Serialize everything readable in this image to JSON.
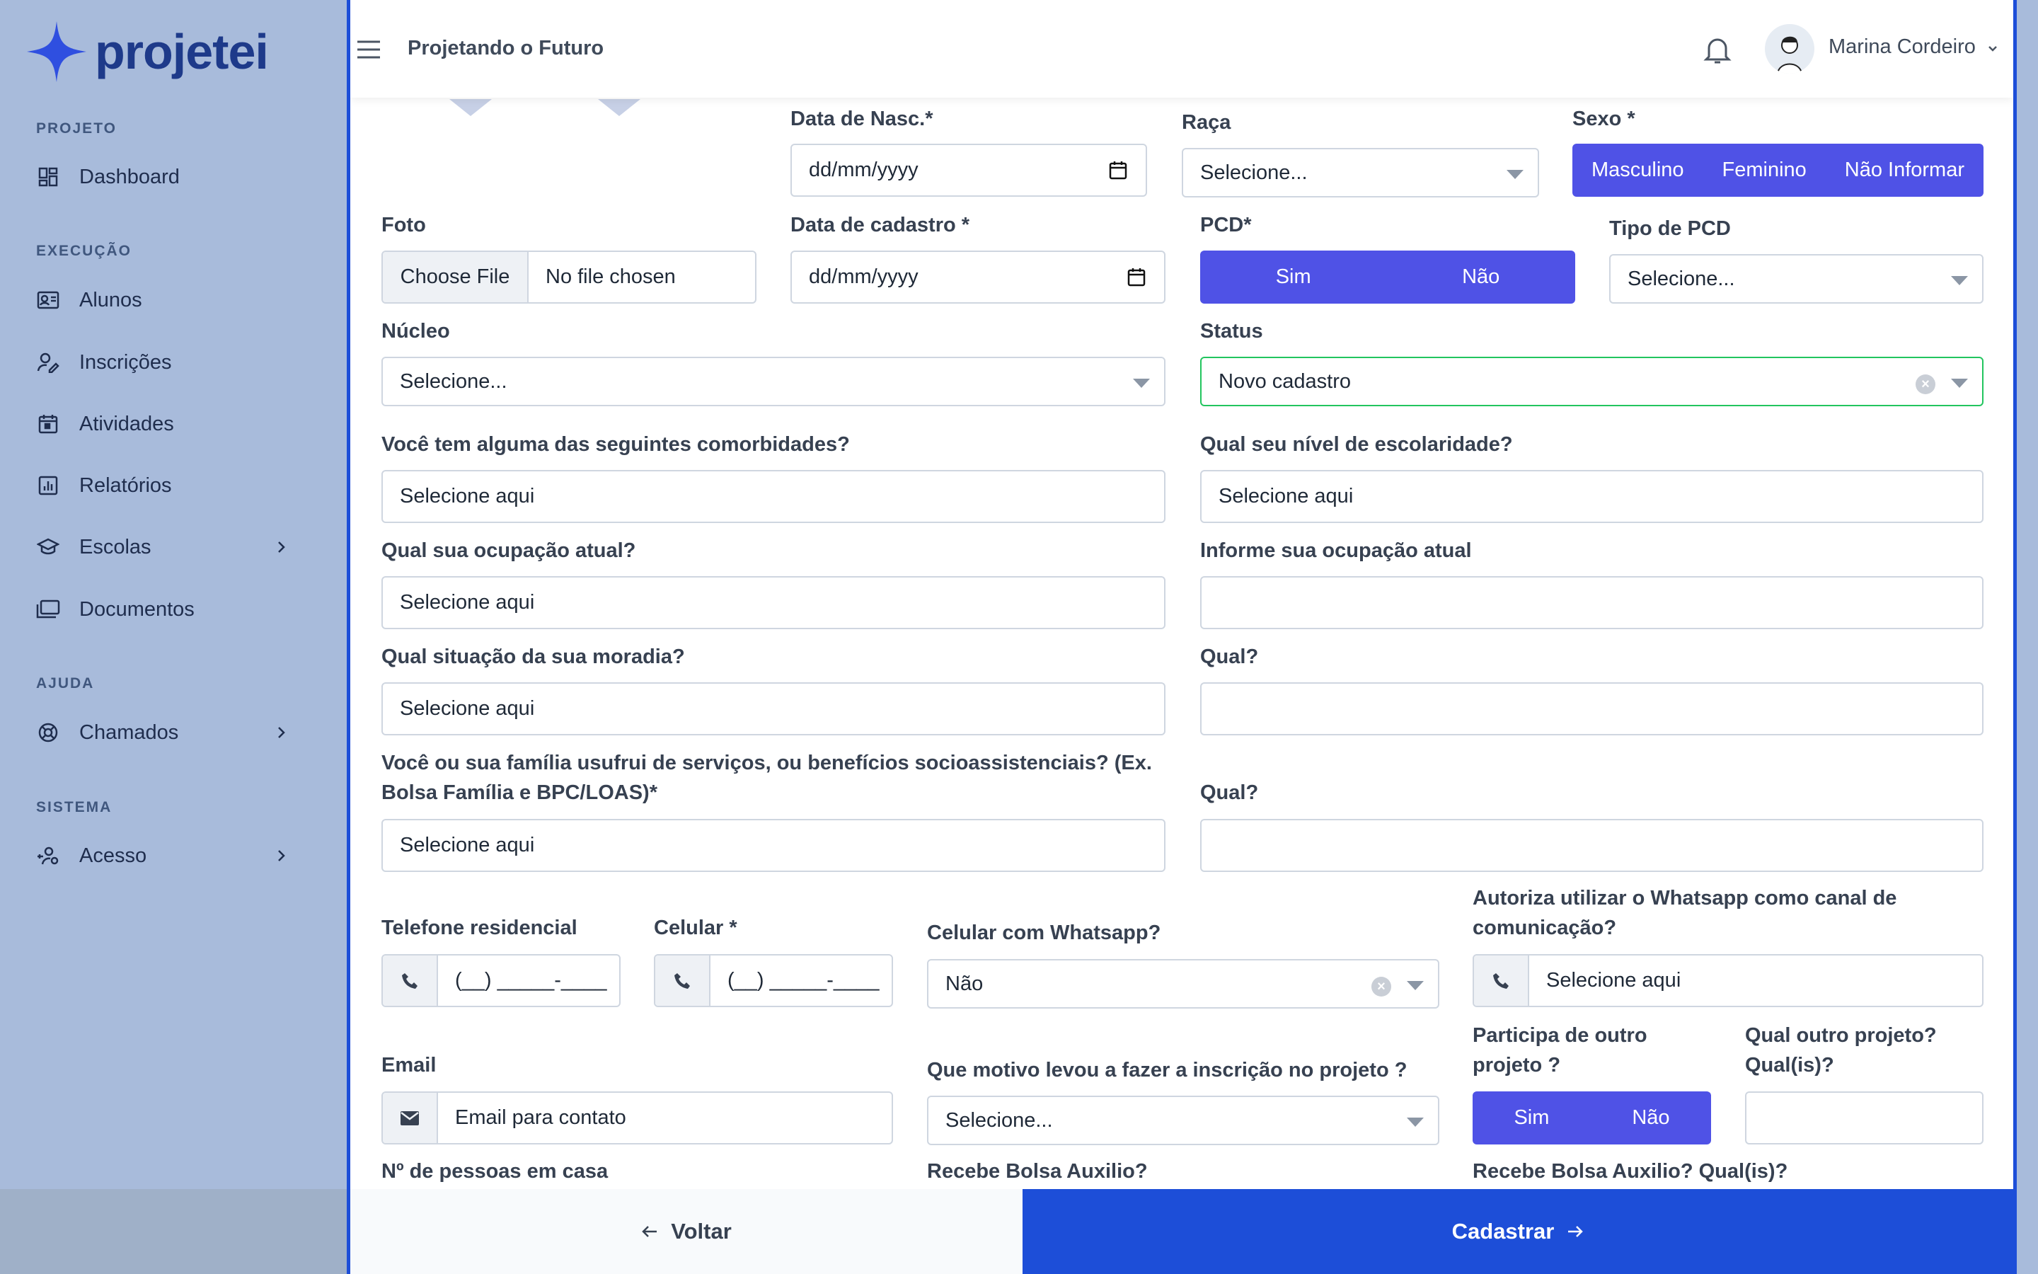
{
  "brand": {
    "name": "projetei"
  },
  "sidebar": {
    "sections": [
      {
        "title": "PROJETO"
      },
      {
        "title": "EXECUÇÃO"
      },
      {
        "title": "AJUDA"
      },
      {
        "title": "SISTEMA"
      }
    ],
    "items": [
      {
        "label": "Dashboard",
        "icon": "dashboard-icon"
      },
      {
        "label": "Alunos",
        "icon": "id-card-icon"
      },
      {
        "label": "Inscrições",
        "icon": "user-edit-icon"
      },
      {
        "label": "Atividades",
        "icon": "calendar-icon"
      },
      {
        "label": "Relatórios",
        "icon": "bar-chart-icon"
      },
      {
        "label": "Escolas",
        "icon": "graduation-cap-icon"
      },
      {
        "label": "Documentos",
        "icon": "folders-icon"
      },
      {
        "label": "Chamados",
        "icon": "lifebuoy-icon"
      },
      {
        "label": "Acesso",
        "icon": "user-key-icon"
      }
    ]
  },
  "header": {
    "title": "Projetando o Futuro",
    "user_name": "Marina Cordeiro"
  },
  "form": {
    "birth_date": {
      "label": "Data de Nasc.*",
      "placeholder": "dd/mm/yyyy"
    },
    "race": {
      "label": "Raça",
      "value": "Selecione..."
    },
    "sex": {
      "label": "Sexo *",
      "options": [
        "Masculino",
        "Feminino",
        "Não Informar"
      ]
    },
    "photo": {
      "label": "Foto",
      "button": "Choose File",
      "status": "No file chosen"
    },
    "register_date": {
      "label": "Data de cadastro *",
      "placeholder": "dd/mm/yyyy"
    },
    "pcd": {
      "label": "PCD*",
      "options": [
        "Sim",
        "Não"
      ]
    },
    "pcd_type": {
      "label": "Tipo de PCD",
      "value": "Selecione..."
    },
    "nucleus": {
      "label": "Núcleo",
      "value": "Selecione..."
    },
    "status": {
      "label": "Status",
      "value": "Novo cadastro"
    },
    "comorbidities": {
      "label": "Você tem alguma das seguintes comorbidades?",
      "value": "Selecione aqui"
    },
    "education": {
      "label": "Qual seu nível de escolaridade?",
      "value": "Selecione aqui"
    },
    "occupation": {
      "label": "Qual sua ocupação atual?",
      "value": "Selecione aqui"
    },
    "occupation_info": {
      "label": "Informe sua ocupação atual",
      "value": ""
    },
    "housing": {
      "label": "Qual situação da sua moradia?",
      "value": "Selecione aqui"
    },
    "housing_which": {
      "label": "Qual?",
      "value": ""
    },
    "benefits": {
      "label": "Você ou sua família usufrui de serviços, ou benefícios socioassistenciais? (Ex. Bolsa Família e BPC/LOAS)*",
      "value": "Selecione aqui"
    },
    "benefits_which": {
      "label": "Qual?",
      "value": ""
    },
    "home_phone": {
      "label": "Telefone residencial",
      "mask": "(__) _____-____"
    },
    "mobile": {
      "label": "Celular *",
      "mask": "(__) _____-____"
    },
    "whatsapp": {
      "label": "Celular com Whatsapp?",
      "value": "Não"
    },
    "whatsapp_auth": {
      "label": "Autoriza utilizar o Whatsapp como canal de comunicação?",
      "value": "Selecione aqui"
    },
    "email": {
      "label": "Email",
      "placeholder": "Email para contato"
    },
    "motive": {
      "label": "Que motivo levou a fazer a inscrição no projeto ?",
      "value": "Selecione..."
    },
    "other_project": {
      "label": "Participa de outro projeto ?",
      "options": [
        "Sim",
        "Não"
      ]
    },
    "other_project_which": {
      "label": "Qual outro projeto? Qual(is)?",
      "value": ""
    },
    "people_home": {
      "label": "Nº de pessoas em casa"
    },
    "aid": {
      "label": "Recebe Bolsa Auxilio?"
    },
    "aid_which": {
      "label": "Recebe Bolsa Auxilio? Qual(is)?"
    }
  },
  "footer": {
    "back_label": "Voltar",
    "submit_label": "Cadastrar"
  },
  "colors": {
    "primary": "#1d4ed8",
    "segment": "#4f52e6",
    "sidebar": "#a8bbdb",
    "status_border": "#22c55e"
  }
}
